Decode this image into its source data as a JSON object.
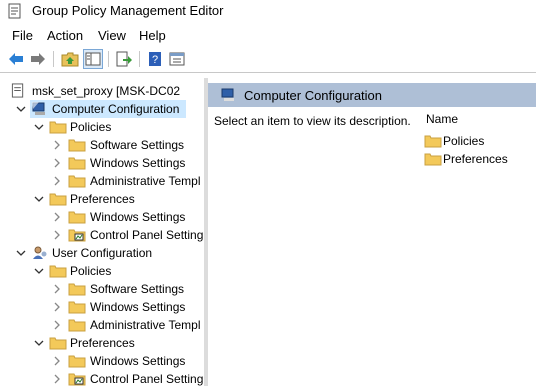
{
  "window": {
    "title": "Group Policy Management Editor"
  },
  "menu": {
    "file": "File",
    "action": "Action",
    "view": "View",
    "help": "Help"
  },
  "tree": {
    "root": "msk_set_proxy [MSK-DC02",
    "computer": {
      "label": "Computer Configuration",
      "policies": {
        "label": "Policies",
        "software": "Software Settings",
        "windows": "Windows Settings",
        "admin": "Administrative Templ"
      },
      "preferences": {
        "label": "Preferences",
        "windows": "Windows Settings",
        "control": "Control Panel Setting"
      }
    },
    "user": {
      "label": "User Configuration",
      "policies": {
        "label": "Policies",
        "software": "Software Settings",
        "windows": "Windows Settings",
        "admin": "Administrative Templ"
      },
      "preferences": {
        "label": "Preferences",
        "windows": "Windows Settings",
        "control": "Control Panel Setting"
      }
    }
  },
  "details": {
    "header": "Computer Configuration",
    "description": "Select an item to view its description.",
    "column_name": "Name",
    "items": [
      "Policies",
      "Preferences"
    ]
  },
  "icons": {
    "app": "policy-document-icon",
    "back": "arrow-left-icon",
    "forward": "arrow-right-icon",
    "up": "up-folder-icon",
    "show_hide_tree": "console-tree-icon",
    "export": "export-list-icon",
    "help": "help-icon",
    "properties": "properties-icon",
    "folder": "folder-icon",
    "computer": "computer-icon",
    "user": "user-icon",
    "control_panel": "control-panel-icon"
  },
  "colors": {
    "header_bg": "#aebfd6",
    "selection": "#cce8ff",
    "folder": "#f3c95a"
  }
}
